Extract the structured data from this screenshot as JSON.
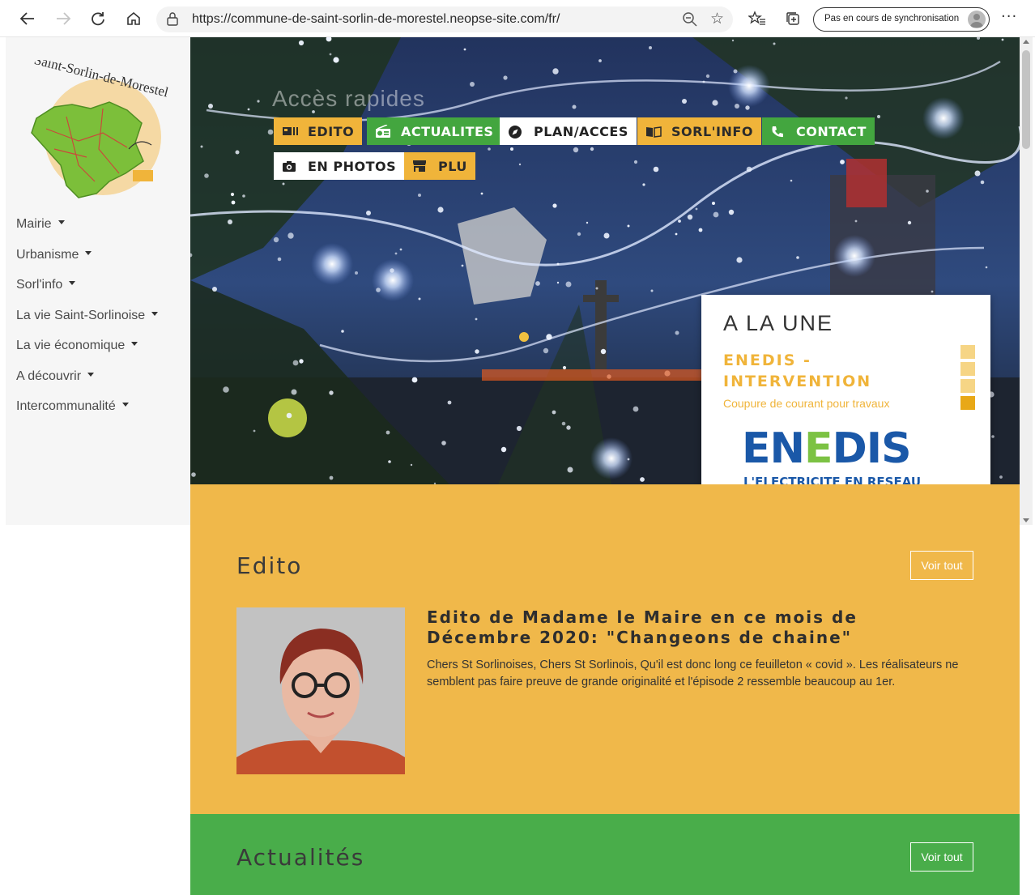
{
  "browser": {
    "url": "https://commune-de-saint-sorlin-de-morestel.neopse-site.com/fr/",
    "sync_label": "Pas en cours de synchronisation",
    "more_label": "···",
    "icons": [
      "back-icon",
      "forward-icon",
      "refresh-icon",
      "home-icon",
      "lock-icon",
      "zoom-icon",
      "favorite-star-icon",
      "favorites-list-icon",
      "collections-icon",
      "profile-icon",
      "more-icon"
    ]
  },
  "sidebar": {
    "logo_text": "Saint-Sorlin-de-Morestel",
    "menu": [
      {
        "label": "Mairie"
      },
      {
        "label": "Urbanisme"
      },
      {
        "label": "Sorl'info"
      },
      {
        "label": "La vie Saint-Sorlinoise"
      },
      {
        "label": "La vie économique"
      },
      {
        "label": "A découvrir"
      },
      {
        "label": "Intercommunalité"
      }
    ]
  },
  "hero": {
    "faint_title": "Accès rapides",
    "quick_links": [
      {
        "label": "EDITO",
        "icon": "newspaper-icon",
        "color": "#f0b43a"
      },
      {
        "label": "ACTUALITES",
        "icon": "radio-icon",
        "color": "#43a63f"
      },
      {
        "label": "PLAN/ACCES",
        "icon": "compass-icon",
        "color": "#ffffff"
      },
      {
        "label": "SORL'INFO",
        "icon": "book-icon",
        "color": "#f0b43a"
      },
      {
        "label": "CONTACT",
        "icon": "phone-icon",
        "color": "#43a63f"
      },
      {
        "label": "EN PHOTOS",
        "icon": "camera-icon",
        "color": "#ffffff"
      },
      {
        "label": "PLU",
        "icon": "store-icon",
        "color": "#f0b43a"
      }
    ]
  },
  "a_la_une": {
    "title": "A LA UNE",
    "headline": "ENEDIS - INTERVENTION",
    "subtitle": "Coupure de courant pour travaux",
    "logo_word": "ENEDIS",
    "logo_tagline": "L'ELECTRICITE EN RESEAU",
    "slides_count": 4,
    "active_slide": 4
  },
  "edito": {
    "section_title": "Edito",
    "voir_tout": "Voir tout",
    "article_title": "Edito de Madame le Maire en ce mois de Décembre 2020: \"Changeons de chaine\"",
    "article_text": "Chers St Sorlinoises, Chers St Sorlinois, Qu'il est donc long ce feuilleton « covid ». Les réalisateurs ne semblent pas faire preuve de grande originalité et l'épisode 2 ressemble beaucoup au 1er."
  },
  "actualites": {
    "section_title": "Actualités",
    "voir_tout": "Voir tout"
  },
  "colors": {
    "yellow": "#f0b43a",
    "edito_bg": "#f0b84a",
    "green": "#43a63f",
    "actus_bg": "#49ad4a",
    "enedis_blue": "#1a58a8",
    "enedis_green": "#7cc243"
  }
}
